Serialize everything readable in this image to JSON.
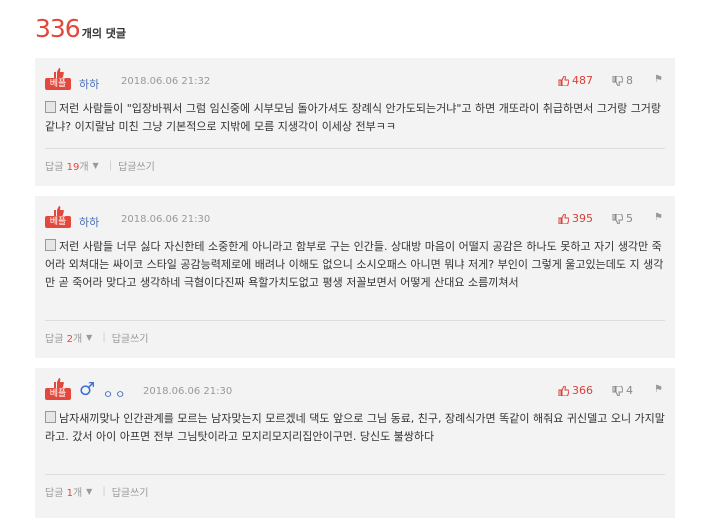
{
  "header": {
    "count": "336",
    "count_label": "개의 댓글"
  },
  "comments": [
    {
      "best_label": "베플",
      "author": "하하",
      "date": "2018.06.06 21:32",
      "likes": "487",
      "dislikes": "8",
      "text": "저런 사람들이 \"입장바꿔서 그럼 임신중에 시부모님 돌아가셔도 장례식 안가도되는거냐\"고 하면 개또라이 취급하면서 그거랑 그거랑 같냐? 이지랄남 미친 그냥 기본적으로 지밖에 모름 지생각이 이세상 전부ㅋㅋ",
      "reply_prefix": "답글",
      "reply_count": "19",
      "reply_suffix": "개",
      "write_reply": "답글쓰기"
    },
    {
      "best_label": "베플",
      "author": "하하",
      "date": "2018.06.06 21:30",
      "likes": "395",
      "dislikes": "5",
      "text": "저런 사람들 너무 싫다 자신한테 소중한게 아니라고 함부로 구는 인간들. 상대방 마음이 어떨지 공감은 하나도 못하고 자기 생각만 죽어라 외쳐대는 싸이코 스타일 공감능력제로에 배려나 이해도 없으니 소시오패스 아니면 뭐냐 저게? 부인이 그렇게 울고있는데도 지 생각만 곧 죽어라 맞다고 생각하네 극혐이다진짜 욕할가치도없고 평생 저꼴보면서 어떻게 산대요 소름끼쳐서",
      "reply_prefix": "답글",
      "reply_count": "2",
      "reply_suffix": "개",
      "write_reply": "답글쓰기"
    },
    {
      "best_label": "베플",
      "author": "ㅇㅇ",
      "gender_icon": "male-symbol",
      "date": "2018.06.06 21:30",
      "likes": "366",
      "dislikes": "4",
      "text": "남자새끼맞나 인간관계를 모르는 남자맞는지 모르겠네 댁도 앞으로 그님 동료, 친구, 장례식가면 똑같이 해줘요 귀신델고 오니 가지말라고. 갔서 아이 아프면 전부 그님탓이라고 모지리모지리집안이구먼. 당신도 불쌍하다",
      "reply_prefix": "답글",
      "reply_count": "1",
      "reply_suffix": "개",
      "write_reply": "답글쓰기"
    }
  ],
  "colors": {
    "accent": "#e2483c",
    "author": "#4a6fb5",
    "card": "#f3f3f3"
  }
}
